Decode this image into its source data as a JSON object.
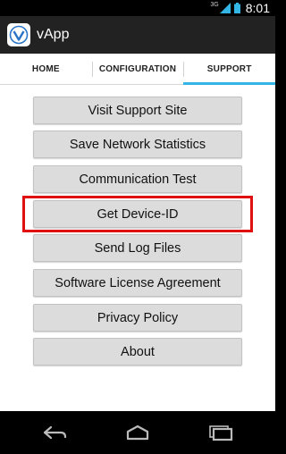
{
  "status_bar": {
    "network": "3G",
    "time": "8:01",
    "icons": [
      "signal-icon",
      "battery-icon"
    ]
  },
  "action_bar": {
    "logo_icon": "vapp-logo-icon",
    "title": "vApp"
  },
  "tabs": [
    {
      "label": "HOME",
      "selected": false
    },
    {
      "label": "CONFIGURATION",
      "selected": false
    },
    {
      "label": "SUPPORT",
      "selected": true
    }
  ],
  "support_buttons": [
    {
      "label": "Visit Support Site"
    },
    {
      "label": "Save Network Statistics"
    },
    {
      "label": "Communication Test"
    },
    {
      "label": "Get Device-ID",
      "highlighted": true
    },
    {
      "label": "Send Log Files"
    },
    {
      "label": "Software License Agreement"
    },
    {
      "label": "Privacy Policy"
    },
    {
      "label": "About"
    }
  ],
  "nav_bar": {
    "icons": [
      "back-icon",
      "home-icon",
      "recent-apps-icon"
    ]
  },
  "colors": {
    "tab_indicator": "#33b5e5",
    "highlight_border": "#e01010",
    "logo_blue": "#2a74c6"
  }
}
